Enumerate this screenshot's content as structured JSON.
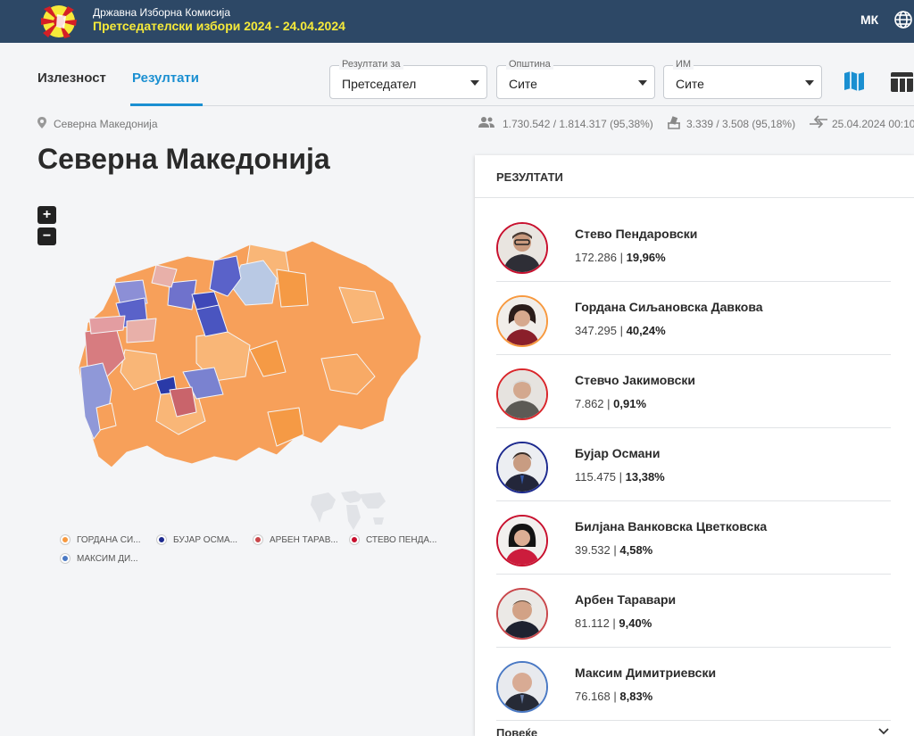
{
  "header": {
    "org": "Државна Изборна Комисија",
    "election": "Претседателски избори 2024 - 24.04.2024",
    "lang": "МК"
  },
  "tabs": {
    "turnout": "Излезност",
    "results": "Резултати",
    "active": "results"
  },
  "filters": [
    {
      "label": "Резултати за",
      "value": "Претседател"
    },
    {
      "label": "Општина",
      "value": "Сите"
    },
    {
      "label": "ИМ",
      "value": "Сите"
    }
  ],
  "breadcrumb": "Северна Македонија",
  "stats": {
    "voters": "1.730.542 / 1.814.317 (95,38%)",
    "stations": "3.339 / 3.508 (95,18%)",
    "updated": "25.04.2024 00:10"
  },
  "page_title": "Северна Македонија",
  "legend": [
    {
      "label": "ГОРДАНА СИ...",
      "color": "#f7993f"
    },
    {
      "label": "БУЈАР ОСМА...",
      "color": "#1d2a8f"
    },
    {
      "label": "АРБЕН ТАРАВ...",
      "color": "#c9474b"
    },
    {
      "label": "СТЕВО ПЕНДА...",
      "color": "#c8102e"
    },
    {
      "label": "МАКСИМ ДИ...",
      "color": "#4a79c4"
    }
  ],
  "results": {
    "title": "РЕЗУЛТАТИ",
    "more": "Повеќе",
    "candidates": [
      {
        "name": "Стево Пендаровски",
        "votes": "172.286",
        "pct": "19,96%",
        "ring": "#c8102e"
      },
      {
        "name": "Гордана Сиљановска Давкова",
        "votes": "347.295",
        "pct": "40,24%",
        "ring": "#f7993f"
      },
      {
        "name": "Стевчо Јакимовски",
        "votes": "7.862",
        "pct": "0,91%",
        "ring": "#d9262b"
      },
      {
        "name": "Бујар Османи",
        "votes": "115.475",
        "pct": "13,38%",
        "ring": "#1d2a8f"
      },
      {
        "name": "Билјана Ванковска Цветковска",
        "votes": "39.532",
        "pct": "4,58%",
        "ring": "#c8102e"
      },
      {
        "name": "Арбен Таравари",
        "votes": "81.112",
        "pct": "9,40%",
        "ring": "#c9474b"
      },
      {
        "name": "Максим Димитриевски",
        "votes": "76.168",
        "pct": "8,83%",
        "ring": "#4a79c4"
      }
    ]
  },
  "icons": {
    "logo": "sdk-logo",
    "globe": "globe-icon",
    "map": "map-icon",
    "table": "table-icon",
    "pin": "location-pin-icon",
    "voters": "people-icon",
    "stations": "ballot-box-icon",
    "updated": "sync-arrows-icon"
  }
}
